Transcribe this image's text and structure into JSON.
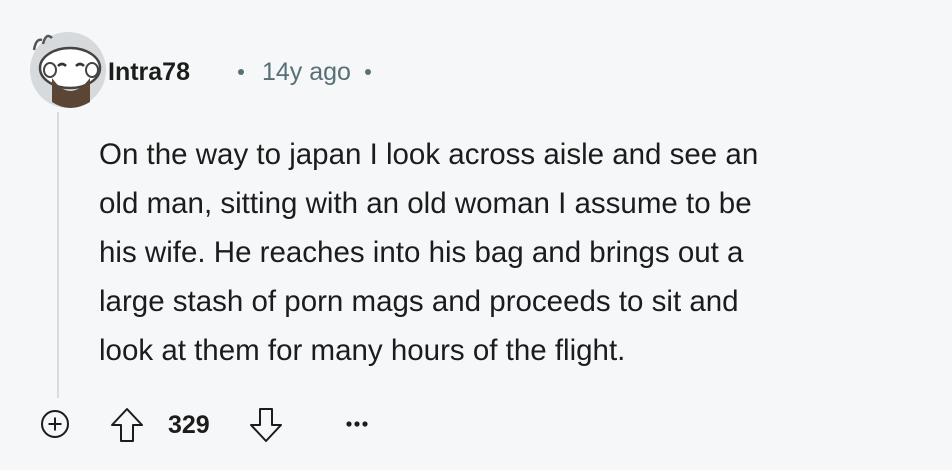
{
  "comment": {
    "author": "Intra78",
    "age": "14y ago",
    "body_lines": [
      "On the way to japan I look across aisle and see an",
      "old man, sitting with an old woman I assume to be",
      "his wife. He reaches into his bag and brings out a",
      "large stash of porn mags and proceeds to sit and",
      "look at them for many hours of the flight."
    ],
    "vote_count": "329"
  },
  "icons": {
    "expand": "plus-circle-icon",
    "upvote": "arrow-up-outline-icon",
    "downvote": "arrow-down-outline-icon",
    "more": "ellipsis-icon",
    "avatar": "snoo-avatar-icon"
  },
  "colors": {
    "background": "#f6f7f8",
    "text": "#1c1c1c",
    "meta": "#576f76",
    "thread_line": "#dadce0"
  }
}
